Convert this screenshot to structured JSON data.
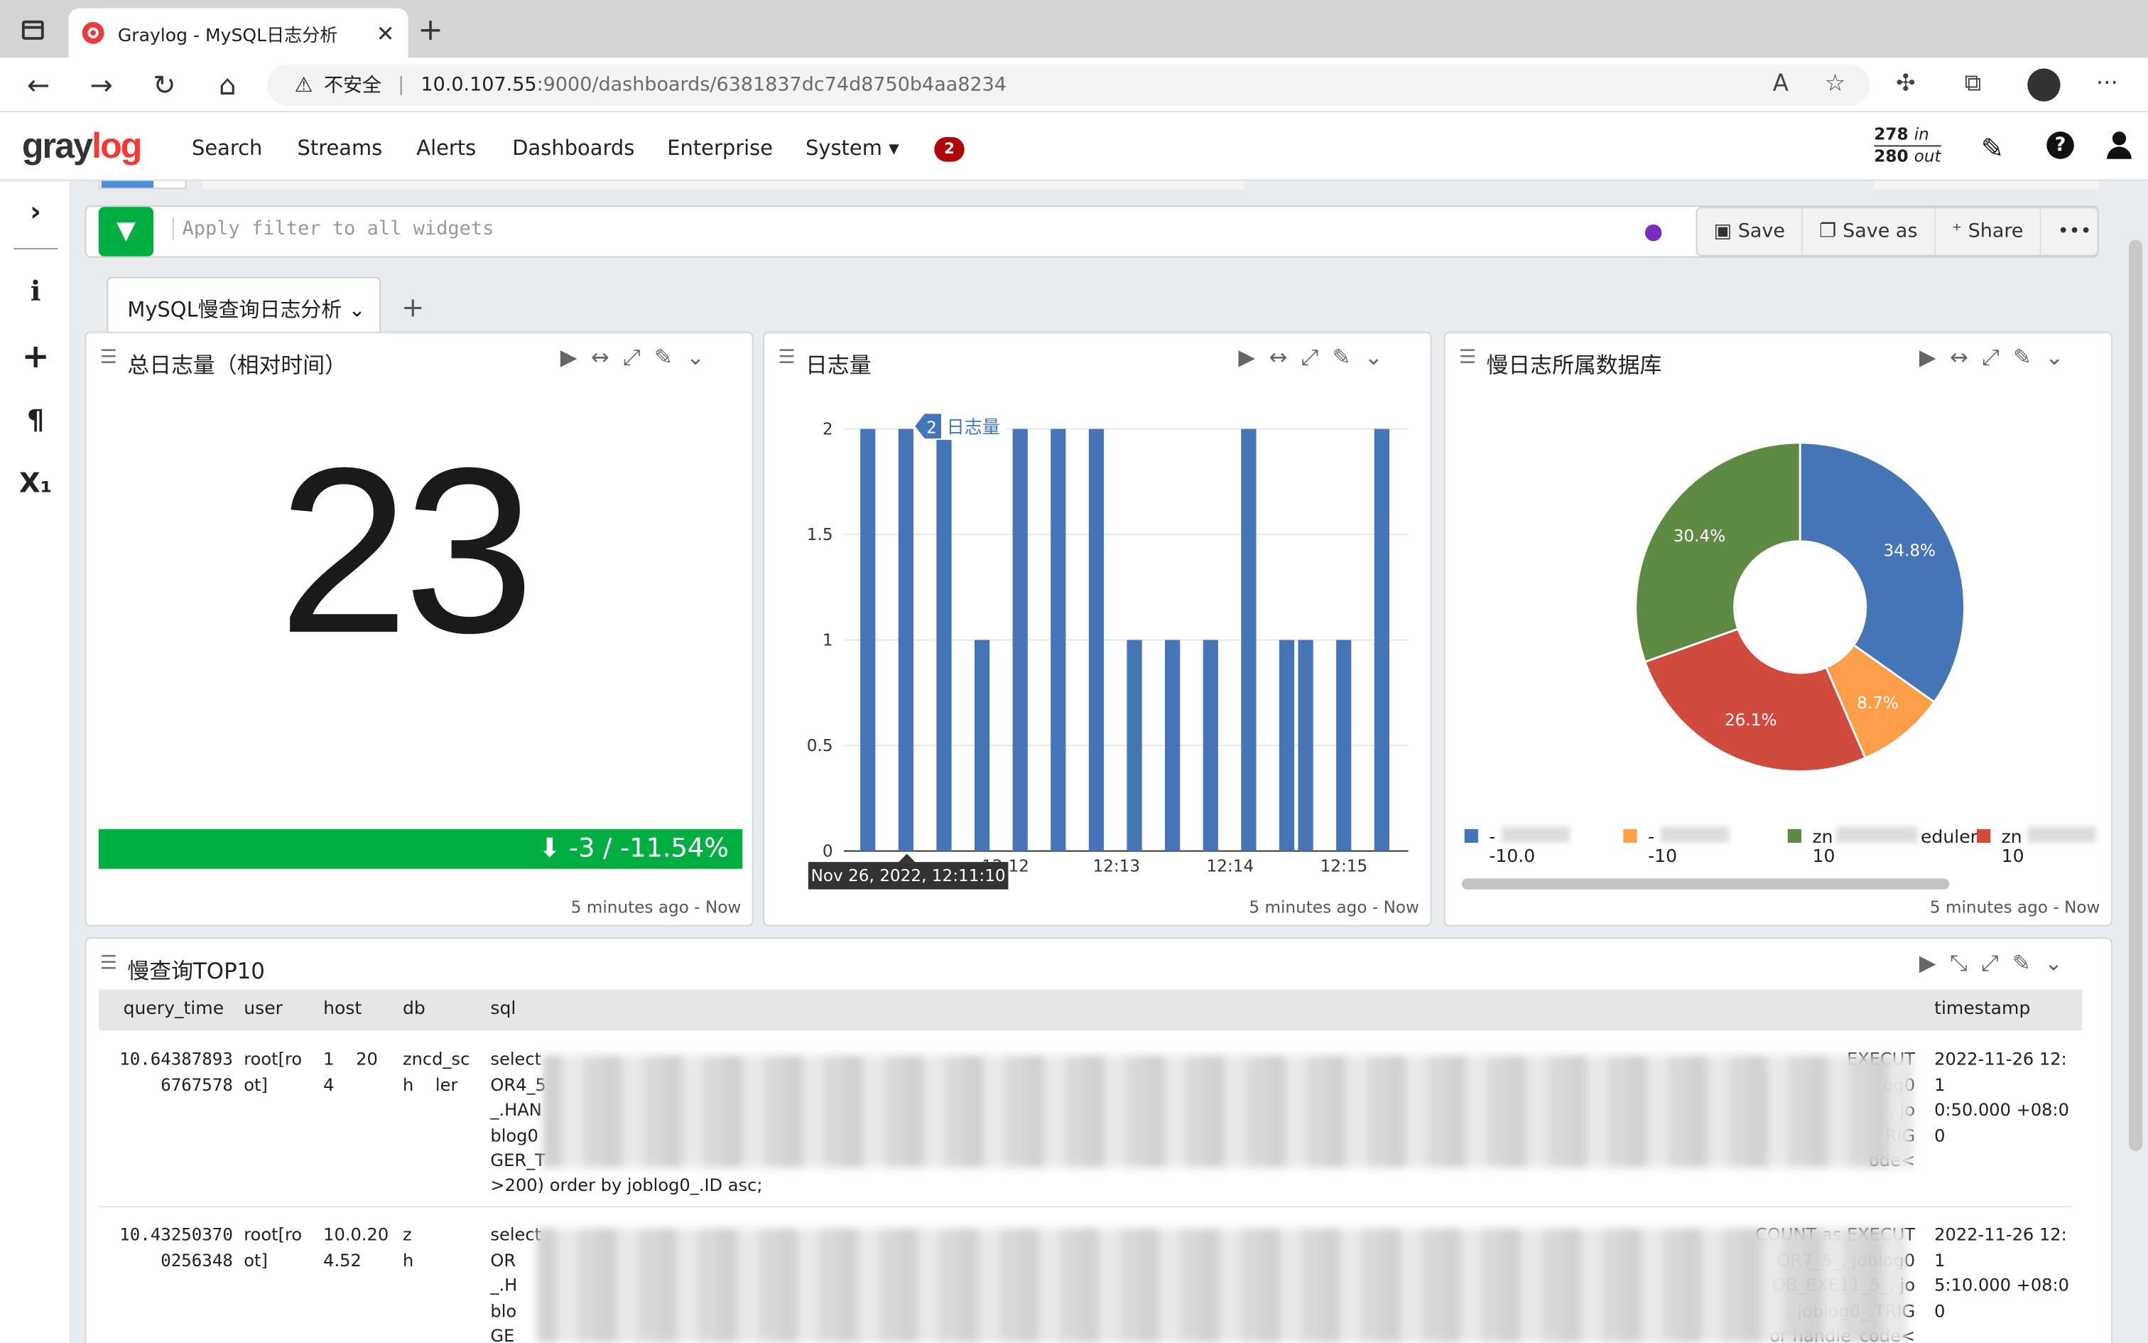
{
  "browser": {
    "tab_title": "Graylog - MySQL日志分析",
    "new_tab": "+",
    "url_warning": "不安全",
    "url_host": "10.0.107.55",
    "url_path": ":9000/dashboards/6381837dc74d8750b4aa8234"
  },
  "nav": {
    "logo_pre": "gray",
    "logo_post": "log",
    "items": [
      "Search",
      "Streams",
      "Alerts",
      "Dashboards",
      "Enterprise",
      "System ▾"
    ],
    "notifications": "2",
    "throughput_in": "278",
    "throughput_in_label": "in",
    "throughput_out": "280",
    "throughput_out_label": "out"
  },
  "searchbar": {
    "placeholder": "Apply filter to all widgets",
    "save": "Save",
    "save_as": "Save as",
    "share": "Share",
    "more": "•••"
  },
  "dashboard_tab": {
    "label": "MySQL慢查询日志分析"
  },
  "widgets": {
    "total": {
      "title": "总日志量（相对时间）",
      "value": "23",
      "trend": "-3 / -11.54%",
      "footer": "5 minutes ago - Now"
    },
    "histogram": {
      "title": "日志量",
      "footer": "5 minutes ago - Now",
      "tooltip_value": "2",
      "tooltip_label": "日志量",
      "hover_label": "Nov 26, 2022, 12:11:10"
    },
    "pie": {
      "title": "慢日志所属数据库",
      "footer": "5 minutes ago - Now"
    },
    "table": {
      "title": "慢查询TOP10"
    }
  },
  "chart_data": [
    {
      "type": "bar",
      "title": "日志量",
      "x_ticks": [
        "12:12",
        "12:13",
        "12:14",
        "12:15"
      ],
      "y_ticks": [
        "0",
        "0.5",
        "1",
        "1.5",
        "2"
      ],
      "ylim": [
        0,
        2
      ],
      "values": [
        2,
        2,
        2,
        1,
        2,
        2,
        2,
        1,
        1,
        1,
        2,
        1,
        1,
        1,
        2
      ],
      "color": "#4575b4"
    },
    {
      "type": "pie",
      "title": "慢日志所属数据库",
      "slices": [
        {
          "label": "34.8%",
          "value": 34.8,
          "color": "#4575b4"
        },
        {
          "label": "8.7%",
          "value": 8.7,
          "color": "#fd9e48"
        },
        {
          "label": "26.1%",
          "value": 26.1,
          "color": "#d14a3e"
        },
        {
          "label": "30.4%",
          "value": 30.4,
          "color": "#5f8a44"
        }
      ],
      "legend": [
        {
          "text": "-",
          "text2": "-10.0",
          "color": "#4575b4"
        },
        {
          "text": "-",
          "text2": "-10",
          "color": "#fd9e48"
        },
        {
          "text": "zn",
          "text2": "10",
          "suffix": "eduler-",
          "color": "#5f8a44"
        },
        {
          "text": "zn",
          "text2": "10",
          "color": "#d14a3e"
        }
      ]
    }
  ],
  "table": {
    "headers": [
      "query_time",
      "user",
      "host",
      "db",
      "sql",
      "timestamp"
    ],
    "rows": [
      {
        "query_time": "10.64387893\n6767578",
        "user": "root[ro\not]",
        "host": "1    20\n4",
        "db": "zncd_sc\nh    ler",
        "sql_start": "select",
        "sql_end": ">200) order by joblog0_.ID asc;",
        "sql_right": [
          "EXECUT",
          "og0",
          ", jo",
          "RIG",
          "ode<"
        ],
        "sql_left": [
          "OR4_5",
          "_.HAN",
          "blog0",
          "GER_T"
        ],
        "timestamp": "2022-11-26 12:1\n0:50.000 +08:00"
      },
      {
        "query_time": "10.43250370\n0256348",
        "user": "root[ro\not]",
        "host": "10.0.20\n4.52",
        "db": "z\nh",
        "sql_start": "select",
        "sql_end": "or handle_code<",
        "sql_right": [
          "COUNT as EXECUT",
          "OR7_5_, joblog0",
          "OB_EXE11_5_, jo",
          ", joblog0_.TRIG",
          "or handle_code<"
        ],
        "sql_left": [
          "OR",
          "_.H",
          "blo",
          "GE"
        ],
        "timestamp": "2022-11-26 12:1\n5:10.000 +08:00"
      }
    ]
  }
}
